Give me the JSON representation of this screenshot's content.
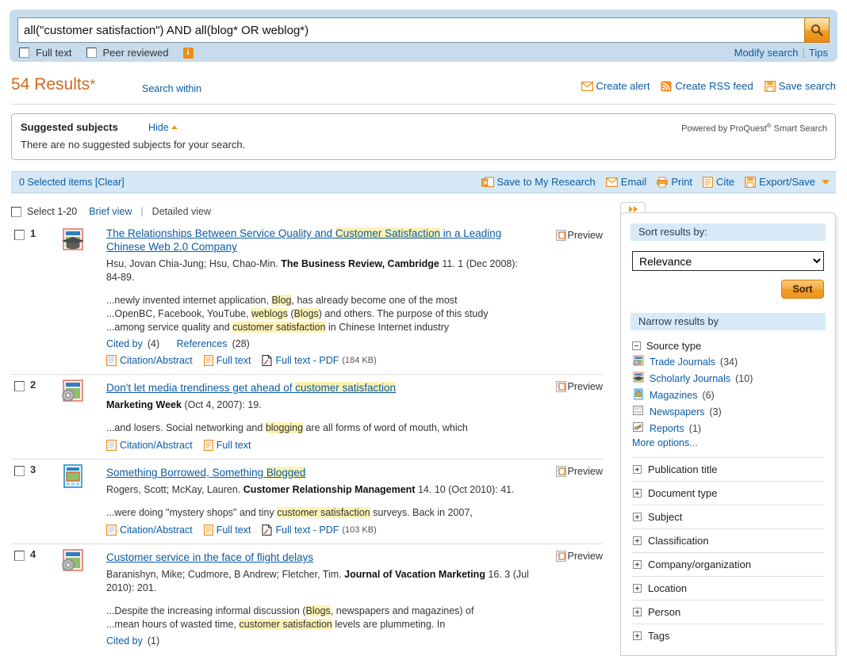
{
  "search": {
    "query": "all(\"customer satisfaction\") AND all(blog* OR weblog*)",
    "placeholder": "Search",
    "search_icon": "magnifier-icon",
    "full_text_label": "Full text",
    "peer_reviewed_label": "Peer reviewed",
    "info_icon": "info-icon",
    "modify_search": "Modify search",
    "tips": "Tips"
  },
  "results_header": {
    "count_text": "54 Results",
    "asterisk": "*",
    "search_within": "Search within",
    "actions": [
      {
        "label": "Create alert",
        "icon": "envelope-icon"
      },
      {
        "label": "Create RSS feed",
        "icon": "rss-icon"
      },
      {
        "label": "Save search",
        "icon": "floppy-disk-icon"
      }
    ]
  },
  "suggested_subjects": {
    "title": "Suggested subjects",
    "hide_label": "Hide",
    "body": "There are no suggested subjects for your search.",
    "powered_prefix": "Powered by ProQuest",
    "powered_sup": "®",
    "powered_suffix": "Smart Search"
  },
  "action_bar": {
    "selected_text": "0 Selected items [Clear]",
    "actions": [
      {
        "label": "Save to My Research",
        "icon": "save-research-icon"
      },
      {
        "label": "Email",
        "icon": "envelope-icon"
      },
      {
        "label": "Print",
        "icon": "printer-icon"
      },
      {
        "label": "Cite",
        "icon": "cite-icon"
      },
      {
        "label": "Export/Save",
        "icon": "floppy-disk-icon"
      }
    ]
  },
  "select_row": {
    "select_label": "Select 1-20",
    "brief_view": "Brief view",
    "divider": "|",
    "detailed_view": "Detailed view"
  },
  "results": [
    {
      "number": "1",
      "icon": "scholarly-journal-icon",
      "title_parts": [
        {
          "text": "The Relationships Between Service Quality and ",
          "highlight": false
        },
        {
          "text": "Customer Satisfaction",
          "highlight": true
        },
        {
          "text": " in a Leading Chinese Web 2.0 Company",
          "highlight": false
        }
      ],
      "meta_authors": "Hsu, Jovan Chia-Jung; Hsu, Chao-Min.",
      "meta_publication": "The Business Review, Cambridge",
      "meta_rest": "11. 1  (Dec 2008): 84-89.",
      "snippets": [
        [
          {
            "text": "...newly invented internet application, ",
            "highlight": false
          },
          {
            "text": "Blog",
            "highlight": true
          },
          {
            "text": ", has already become one of the most",
            "highlight": false
          }
        ],
        [
          {
            "text": "...OpenBC, Facebook, YouTube, ",
            "highlight": false
          },
          {
            "text": "weblogs",
            "highlight": true
          },
          {
            "text": " (",
            "highlight": false
          },
          {
            "text": "Blogs",
            "highlight": true
          },
          {
            "text": ") and others. The purpose of this study",
            "highlight": false
          }
        ],
        [
          {
            "text": "...among service quality and ",
            "highlight": false
          },
          {
            "text": "customer satisfaction",
            "highlight": true
          },
          {
            "text": " in Chinese Internet industry",
            "highlight": false
          }
        ]
      ],
      "cited_by_label": "Cited by",
      "cited_by_count": "(4)",
      "references_label": "References",
      "references_count": "(28)",
      "links": [
        {
          "label": "Citation/Abstract",
          "icon": "document-icon",
          "size": ""
        },
        {
          "label": "Full text",
          "icon": "fulltext-icon",
          "size": ""
        },
        {
          "label": "Full text - PDF",
          "icon": "pdf-icon",
          "size": "(184 KB)"
        }
      ],
      "preview_label": "Preview"
    },
    {
      "number": "2",
      "icon": "trade-journal-icon",
      "title_parts": [
        {
          "text": "Don't let media trendiness get ahead of ",
          "highlight": false
        },
        {
          "text": "customer satisfaction",
          "highlight": true
        }
      ],
      "meta_authors": "",
      "meta_publication": "Marketing Week",
      "meta_rest": "(Oct 4, 2007): 19.",
      "snippets": [
        [
          {
            "text": "...and losers. Social networking and ",
            "highlight": false
          },
          {
            "text": "blogging",
            "highlight": true
          },
          {
            "text": " are all forms of word of mouth, which",
            "highlight": false
          }
        ]
      ],
      "cited_by_label": "",
      "cited_by_count": "",
      "references_label": "",
      "references_count": "",
      "links": [
        {
          "label": "Citation/Abstract",
          "icon": "document-icon",
          "size": ""
        },
        {
          "label": "Full text",
          "icon": "fulltext-icon",
          "size": ""
        }
      ],
      "preview_label": "Preview"
    },
    {
      "number": "3",
      "icon": "magazine-icon",
      "title_parts": [
        {
          "text": "Something Borrowed, Something ",
          "highlight": false
        },
        {
          "text": "Blogged",
          "highlight": true
        }
      ],
      "meta_authors": "Rogers, Scott; McKay, Lauren.",
      "meta_publication": "Customer Relationship Management",
      "meta_rest": "14. 10  (Oct 2010): 41.",
      "snippets": [
        [
          {
            "text": "...were doing \"mystery shops\" and tiny ",
            "highlight": false
          },
          {
            "text": "customer satisfaction",
            "highlight": true
          },
          {
            "text": " surveys. Back in 2007,",
            "highlight": false
          }
        ]
      ],
      "cited_by_label": "",
      "cited_by_count": "",
      "references_label": "",
      "references_count": "",
      "links": [
        {
          "label": "Citation/Abstract",
          "icon": "document-icon",
          "size": ""
        },
        {
          "label": "Full text",
          "icon": "fulltext-icon",
          "size": ""
        },
        {
          "label": "Full text - PDF",
          "icon": "pdf-icon",
          "size": "(103 KB)"
        }
      ],
      "preview_label": "Preview"
    },
    {
      "number": "4",
      "icon": "trade-journal-icon",
      "title_parts": [
        {
          "text": "Customer service in the face of flight delays",
          "highlight": false
        }
      ],
      "meta_authors": "Baranishyn, Mike; Cudmore, B Andrew; Fletcher, Tim.",
      "meta_publication": "Journal of Vacation Marketing",
      "meta_rest": "16. 3  (Jul 2010): 201.",
      "snippets": [
        [
          {
            "text": "...Despite the increasing informal discussion (",
            "highlight": false
          },
          {
            "text": "Blogs",
            "highlight": true
          },
          {
            "text": ", newspapers and magazines) of",
            "highlight": false
          }
        ],
        [
          {
            "text": "...mean hours of wasted time, ",
            "highlight": false
          },
          {
            "text": "customer satisfaction",
            "highlight": true
          },
          {
            "text": " levels are plummeting. In",
            "highlight": false
          }
        ]
      ],
      "cited_by_label": "Cited by",
      "cited_by_count": "(1)",
      "references_label": "",
      "references_count": "",
      "links": [],
      "preview_label": "Preview"
    }
  ],
  "sidebar": {
    "tab_icon": "double-arrow-right-icon",
    "sort_header": "Sort results by:",
    "sort_selected": "Relevance",
    "sort_options": [
      "Relevance"
    ],
    "sort_button": "Sort",
    "narrow_header": "Narrow results by",
    "source_type_label": "Source type",
    "source_types": [
      {
        "label": "Trade Journals",
        "count": "(34)",
        "icon": "trade-journal-icon"
      },
      {
        "label": "Scholarly Journals",
        "count": "(10)",
        "icon": "scholarly-journal-icon"
      },
      {
        "label": "Magazines",
        "count": "(6)",
        "icon": "magazine-icon"
      },
      {
        "label": "Newspapers",
        "count": "(3)",
        "icon": "newspaper-icon"
      },
      {
        "label": "Reports",
        "count": "(1)",
        "icon": "report-chart-icon"
      }
    ],
    "more_options": "More options...",
    "facets": [
      "Publication title",
      "Document type",
      "Subject",
      "Classification",
      "Company/organization",
      "Location",
      "Person",
      "Tags"
    ]
  },
  "colors": {
    "band_blue": "#c6dcec",
    "action_bar_blue": "#d6e8f5",
    "link_blue": "#0b5ba6",
    "accent_orange": "#f0991a",
    "results_orange": "#d2691e",
    "highlight_yellow": "#fdf3b5"
  }
}
